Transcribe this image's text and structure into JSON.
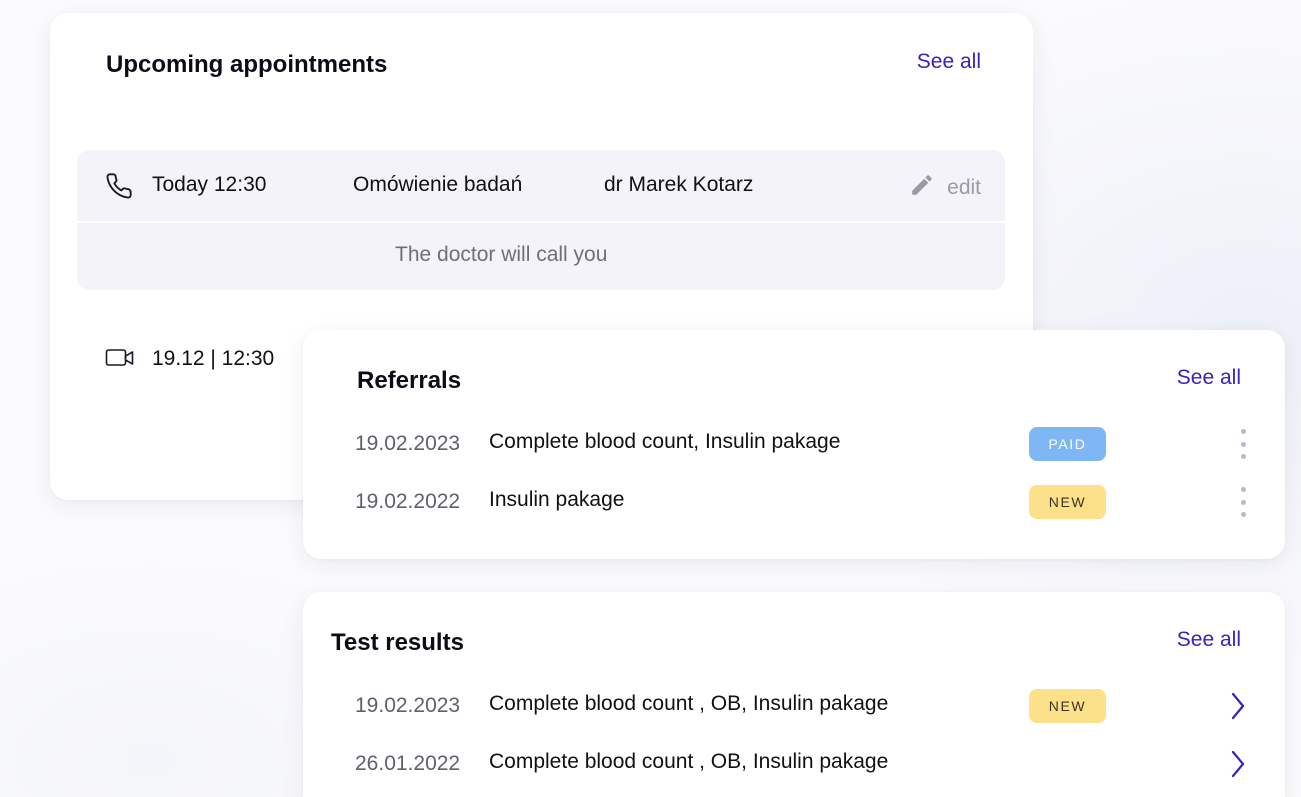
{
  "appointments": {
    "title": "Upcoming appointments",
    "see_all": "See all",
    "items": [
      {
        "icon": "phone-icon",
        "datetime": "Today 12:30",
        "service": "Omówienie badań",
        "doctor": "dr Marek Kotarz",
        "edit_label": "edit",
        "note": "The doctor will call you"
      },
      {
        "icon": "video-camera-icon",
        "datetime": "19.12 | 12:30"
      }
    ]
  },
  "referrals": {
    "title": "Referrals",
    "see_all": "See all",
    "items": [
      {
        "date": "19.02.2023",
        "title": "Complete blood count, Insulin pakage",
        "badge": "PAID",
        "badge_color": "#7fb6f4"
      },
      {
        "date": "19.02.2022",
        "title": "Insulin pakage",
        "badge": "NEW",
        "badge_color": "#fce08a"
      }
    ]
  },
  "test_results": {
    "title": "Test results",
    "see_all": "See all",
    "items": [
      {
        "date": "19.02.2023",
        "title": "Complete blood count , OB, Insulin pakage",
        "badge": "NEW",
        "badge_color": "#fce08a"
      },
      {
        "date": "26.01.2022",
        "title": "Complete blood count , OB, Insulin pakage"
      }
    ]
  },
  "colors": {
    "accent": "#3b21b8",
    "highlight_bg": "#f3f3f9",
    "badge_paid": "#7fb6f4",
    "badge_new": "#fce08a"
  }
}
